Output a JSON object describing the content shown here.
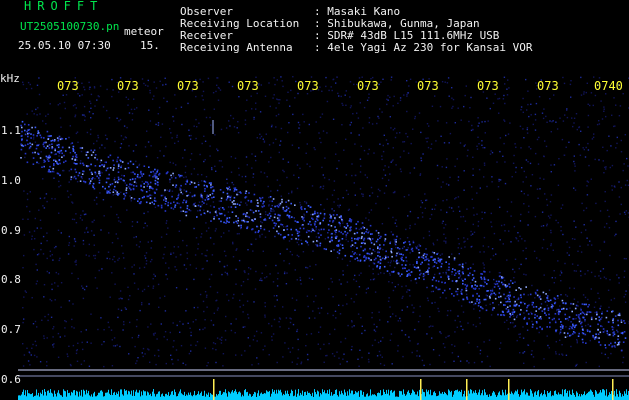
{
  "header": {
    "app_title": "HROFFT",
    "file_name": "UT2505100730.pn",
    "detector": "meteor",
    "datetime": "25.05.10 07:30",
    "level": "15.",
    "fields": [
      {
        "label": "Observer",
        "value": ": Masaki Kano"
      },
      {
        "label": "Receiving Location",
        "value": ": Shibukawa, Gunma, Japan"
      },
      {
        "label": "Receiver",
        "value": ": SDR# 43dB L15 111.6MHz USB"
      },
      {
        "label": "Receiving Antenna",
        "value": ": 4ele Yagi Az 230 for Kansai VOR"
      }
    ]
  },
  "axis": {
    "y_unit": "kHz",
    "y_ticks": [
      "1.1",
      "1.0",
      "0.9",
      "0.8",
      "0.7",
      "0.6"
    ],
    "x_ticks": [
      "073",
      "073",
      "073",
      "073",
      "073",
      "073",
      "073",
      "073",
      "073",
      "0740"
    ]
  },
  "colors": {
    "background": "#000000",
    "header_label": "#f2f2f2",
    "title": "#00e64d",
    "time_tick": "#ffff33",
    "signal": "#3a5cff",
    "noise": "#11145a",
    "baseline": "#00ccff"
  }
}
